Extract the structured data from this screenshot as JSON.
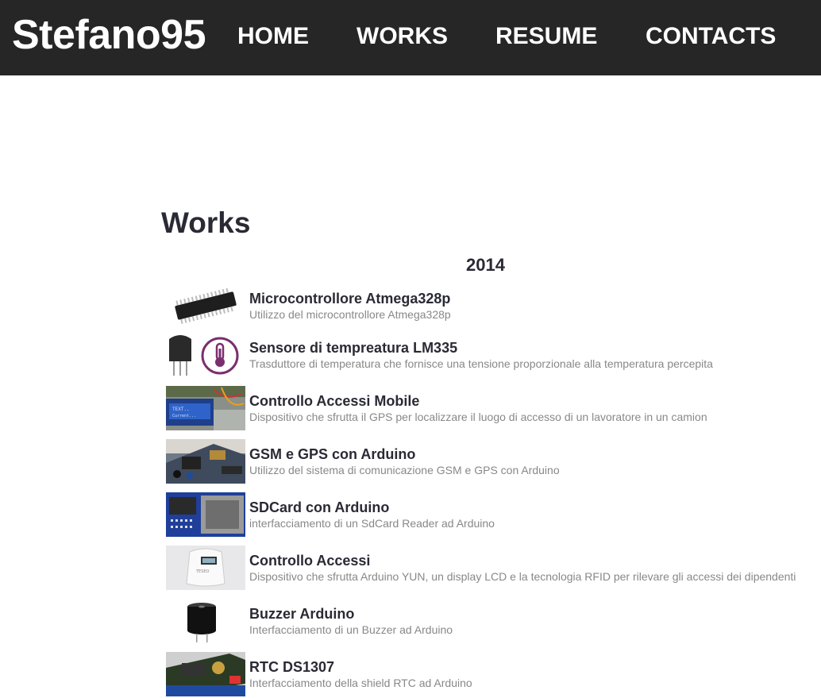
{
  "navbar": {
    "brand": "Stefano95",
    "links": [
      "HOME",
      "WORKS",
      "RESUME",
      "CONTACTS"
    ]
  },
  "main": {
    "title": "Works",
    "year": "2014",
    "works": [
      {
        "title": "Microcontrollore Atmega328p",
        "description": "Utilizzo del microcontrollore Atmega328p",
        "thumb_icon": "atmega-chip-icon"
      },
      {
        "title": "Sensore di tempreatura LM335",
        "description": "Trasduttore di temperatura che fornisce una tensione proporzionale alla temperatura percepita",
        "thumb_icon": "temperature-sensor-icon"
      },
      {
        "title": "Controllo Accessi Mobile",
        "description": "Dispositivo che sfrutta il GPS per localizzare il luogo di accesso di un lavoratore in un camion",
        "thumb_icon": "lcd-board-photo"
      },
      {
        "title": "GSM e GPS con Arduino",
        "description": "Utilizzo del sistema di comunicazione GSM e GPS con Arduino",
        "thumb_icon": "gsm-gps-board-photo"
      },
      {
        "title": "SDCard con Arduino",
        "description": "interfacciamento di un SdCard Reader ad Arduino",
        "thumb_icon": "sdcard-module-photo"
      },
      {
        "title": "Controllo Accessi",
        "description": "Dispositivo che sfrutta Arduino YUN, un display LCD e la tecnologia RFID per rilevare gli accessi dei dipendenti",
        "thumb_icon": "access-terminal-photo"
      },
      {
        "title": "Buzzer Arduino",
        "description": "Interfacciamento di un Buzzer ad Arduino",
        "thumb_icon": "buzzer-icon"
      },
      {
        "title": "RTC DS1307",
        "description": "Interfacciamento della shield RTC ad Arduino",
        "thumb_icon": "rtc-shield-photo"
      }
    ]
  },
  "colors": {
    "navbar_bg": "#262626",
    "heading": "#2a2a35",
    "description": "#888888"
  }
}
